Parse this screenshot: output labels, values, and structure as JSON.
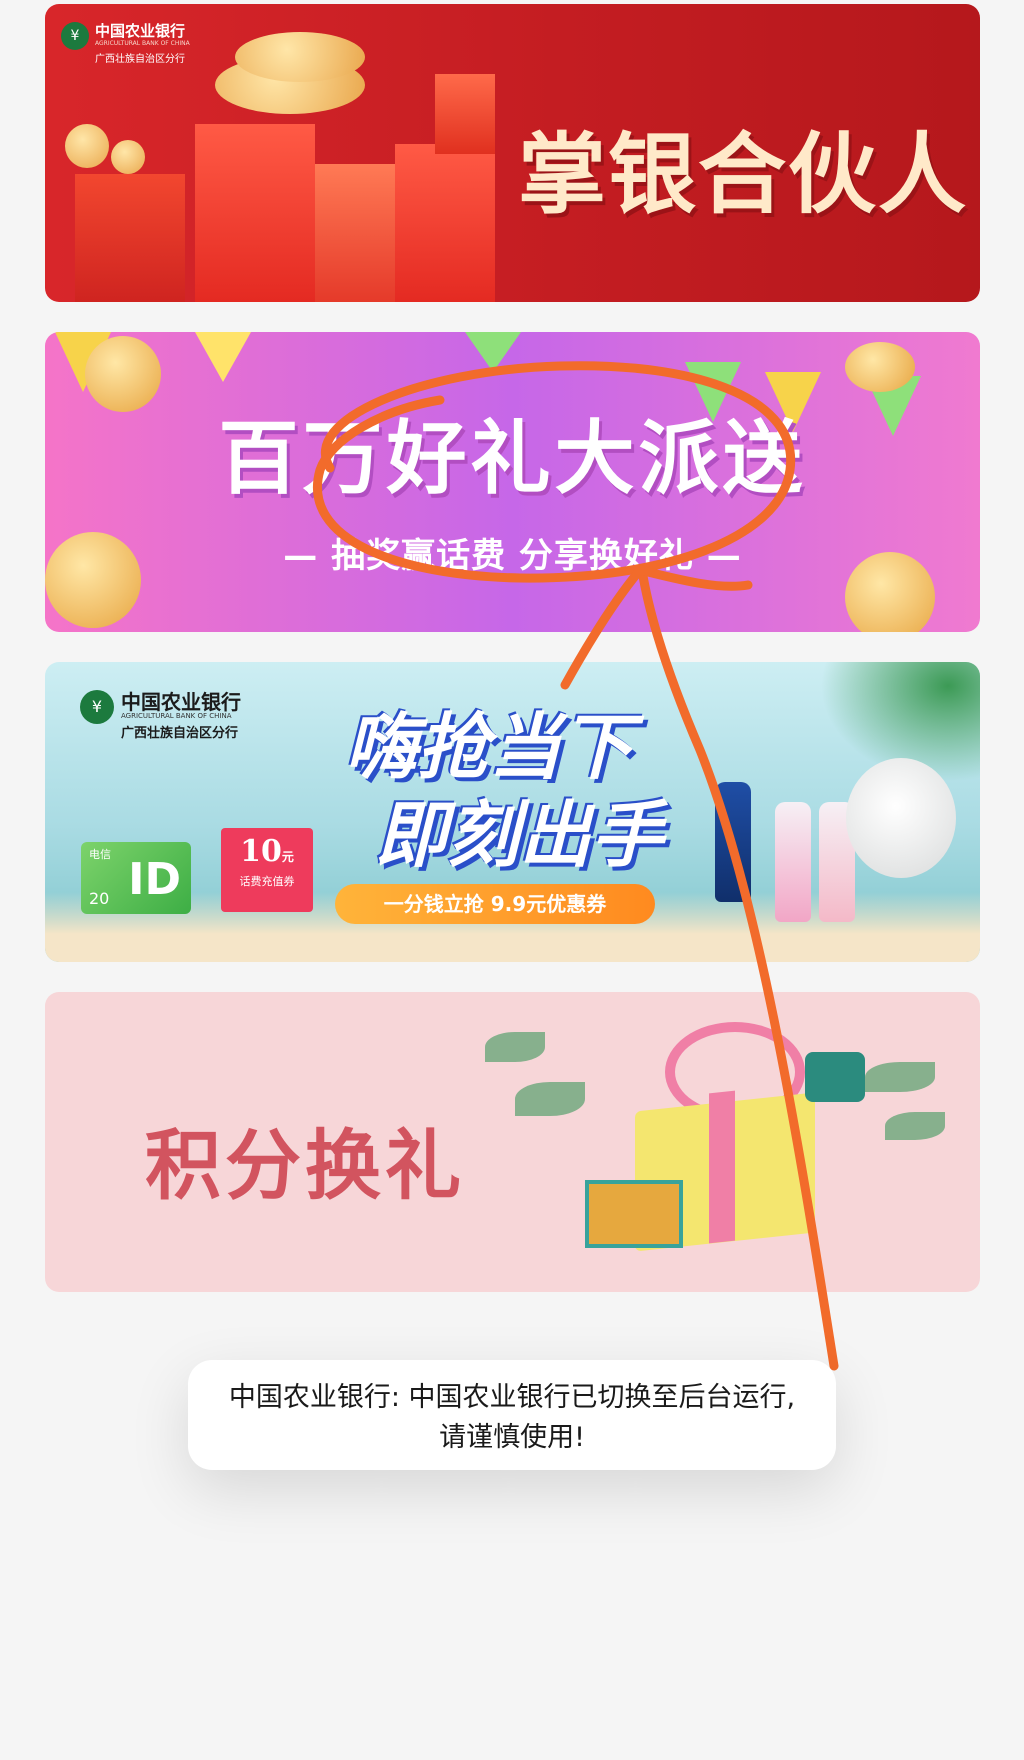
{
  "banners": [
    {
      "logo_cn": "中国农业银行",
      "logo_en": "AGRICULTURAL BANK OF CHINA",
      "logo_sub": "广西壮族自治区分行",
      "title": "掌银合伙人"
    },
    {
      "title": "百万好礼大派送",
      "subtitle": "— 抽奖赢话费 分享换好礼 —"
    },
    {
      "logo_cn": "中国农业银行",
      "logo_en": "AGRICULTURAL BANK OF CHINA",
      "logo_sub": "广西壮族自治区分行",
      "title_line1": "嗨抢当下",
      "title_line2": "即刻出手",
      "promo": "一分钱立抢 9.9元优惠券",
      "card_brand": "电信",
      "card_value": "20",
      "card_big": "ID",
      "coupon_amount": "10",
      "coupon_unit": "元",
      "coupon_label": "话费充值券"
    },
    {
      "title": "积分换礼"
    }
  ],
  "toast": {
    "message": "中国农业银行: 中国农业银行已切换至后台运行,请谨慎使用!"
  },
  "colors": {
    "annotation": "#f26b2b",
    "background": "#f5f5f5"
  }
}
